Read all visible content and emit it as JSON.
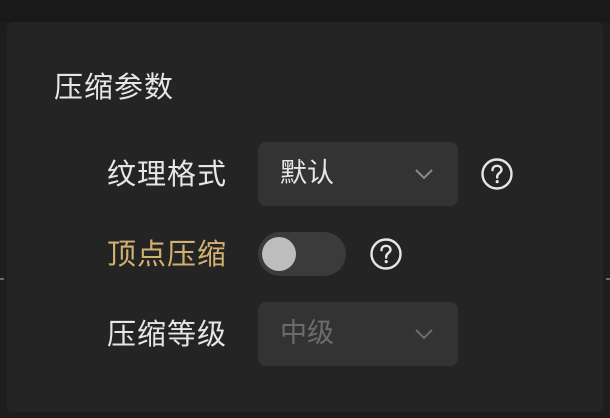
{
  "section": {
    "title": "压缩参数"
  },
  "rows": [
    {
      "label": "纹理格式",
      "control": "select",
      "value": "默认",
      "disabled": false,
      "has_help": true
    },
    {
      "label": "顶点压缩",
      "control": "toggle",
      "checked": false,
      "has_help": true
    },
    {
      "label": "压缩等级",
      "control": "select",
      "value": "中级",
      "disabled": true,
      "has_help": false
    }
  ],
  "icons": {
    "help": "question-circle-icon",
    "chevron": "chevron-down-icon"
  },
  "colors": {
    "panel_bg": "#242424",
    "page_bg": "#1d1d1d",
    "text": "#e6e6e6",
    "accent_label": "#d2b170",
    "control_bg": "#333333",
    "disabled_text": "#6c6c6c",
    "toggle_track": "#3b3b3b",
    "toggle_knob": "#bdbdbd"
  }
}
